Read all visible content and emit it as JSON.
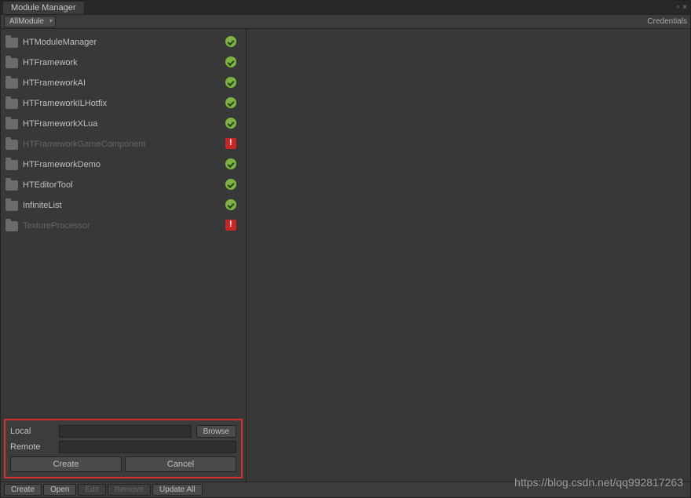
{
  "window": {
    "title": "Module Manager"
  },
  "topbar": {
    "dropdown": "AllModule",
    "credentials": "Credentials"
  },
  "modules": [
    {
      "name": "HTModuleManager",
      "status": "ok",
      "enabled": true
    },
    {
      "name": "HTFramework",
      "status": "ok",
      "enabled": true
    },
    {
      "name": "HTFrameworkAI",
      "status": "ok",
      "enabled": true
    },
    {
      "name": "HTFrameworkILHotfix",
      "status": "ok",
      "enabled": true
    },
    {
      "name": "HTFrameworkXLua",
      "status": "ok",
      "enabled": true
    },
    {
      "name": "HTFrameworkGameComponent",
      "status": "warn",
      "enabled": false
    },
    {
      "name": "HTFrameworkDemo",
      "status": "ok",
      "enabled": true
    },
    {
      "name": "HTEditorTool",
      "status": "ok",
      "enabled": true
    },
    {
      "name": "InfiniteList",
      "status": "ok",
      "enabled": true
    },
    {
      "name": "TextureProcessor",
      "status": "warn",
      "enabled": false
    }
  ],
  "form": {
    "local_label": "Local",
    "remote_label": "Remote",
    "browse": "Browse",
    "create": "Create",
    "cancel": "Cancel",
    "local_value": "",
    "remote_value": ""
  },
  "bottombar": {
    "create": "Create",
    "open": "Open",
    "edit": "Edit",
    "remove": "Remove",
    "update_all": "Update All"
  },
  "watermark": "https://blog.csdn.net/qq992817263"
}
